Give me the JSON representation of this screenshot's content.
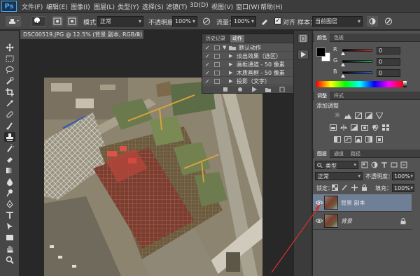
{
  "menubar": {
    "logo": "Ps",
    "items": [
      "文件(F)",
      "编辑(E)",
      "图像(I)",
      "图层(L)",
      "类型(Y)",
      "选择(S)",
      "滤镜(T)",
      "3D(D)",
      "视图(V)",
      "窗口(W)",
      "帮助(H)"
    ]
  },
  "options": {
    "brush_size": "40",
    "mode_label": "模式：",
    "mode_value": "正常",
    "opacity_label": "不透明度：",
    "opacity_value": "100%",
    "flow_label": "流量：",
    "flow_value": "100%",
    "align_label": "对齐",
    "align_checked": "✓",
    "sample_label": "样本：",
    "sample_value": "当前图层"
  },
  "document": {
    "tab_title": "DSC00519.JPG @ 12.5% (背景 副本, RGB/8) *",
    "close_glyph": "×"
  },
  "actions_panel": {
    "tabs": [
      "历史记录",
      "动作"
    ],
    "active_tab": 1,
    "rows": [
      {
        "check": "✓",
        "arrow": "▼",
        "label": "默认动作",
        "is_set": true
      },
      {
        "check": "✓",
        "arrow": "▶",
        "label": "淡出效果（选区）",
        "is_set": false
      },
      {
        "check": "✓",
        "arrow": "▶",
        "label": "画框通道 - 50 像素",
        "is_set": false
      },
      {
        "check": "✓",
        "arrow": "▶",
        "label": "木质画框 - 50 像素",
        "is_set": false
      },
      {
        "check": "✓",
        "arrow": "▶",
        "label": "投影（文字）",
        "is_set": false
      }
    ]
  },
  "color_panel": {
    "tabs": [
      "颜色",
      "色板"
    ],
    "channels": [
      {
        "label": "R",
        "value": "0",
        "color": "#c0392b"
      },
      {
        "label": "G",
        "value": "0",
        "color": "#27ae60"
      },
      {
        "label": "B",
        "value": "0",
        "color": "#2e5fd1"
      }
    ]
  },
  "adjustments_panel": {
    "tabs": [
      "调整",
      "样式"
    ],
    "title": "添加调整",
    "icons_row1": [
      "brightness-icon",
      "levels-icon",
      "curves-icon",
      "exposure-icon",
      "vibrance-icon"
    ],
    "icons_row2": [
      "hue-saturation-icon",
      "color-balance-icon",
      "black-white-icon",
      "photo-filter-icon",
      "channel-mixer-icon",
      "color-lookup-icon"
    ],
    "icons_row3": [
      "invert-icon",
      "posterize-icon",
      "threshold-icon",
      "gradient-map-icon",
      "selective-color-icon"
    ]
  },
  "layers_panel": {
    "tabs": [
      "图层",
      "通道",
      "路径"
    ],
    "filter_label": "类型",
    "blend_mode": "正常",
    "opacity_label": "不透明度：",
    "opacity_value": "100%",
    "lock_label": "锁定：",
    "fill_label": "填充：",
    "fill_value": "100%",
    "layers": [
      {
        "name": "背景 副本",
        "selected": true
      },
      {
        "name": "背景",
        "selected": false
      }
    ]
  },
  "colors": {
    "accent_blue": "#3fa9f5",
    "annotation_red": "#d0302a",
    "selected_layer": "#6f7f95"
  }
}
